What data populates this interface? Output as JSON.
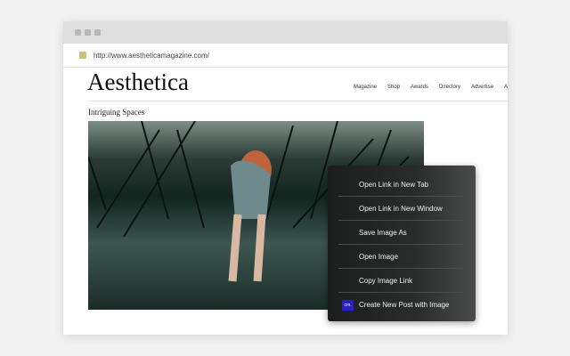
{
  "browser": {
    "url": "http://www.aestheticamagazine.com/"
  },
  "site": {
    "logo": "Aesthetica",
    "nav": [
      "Magazine",
      "Shop",
      "Awards",
      "Directory",
      "Advertise",
      "A"
    ],
    "heading": "Intriguing Spaces"
  },
  "context_menu": {
    "items": [
      "Open Link in New Tab",
      "Open Link in New Window",
      "Save Image As",
      "Open Image",
      "Copy Image Link",
      "Create New Post with Image"
    ],
    "ext_icon_text": "cm."
  }
}
